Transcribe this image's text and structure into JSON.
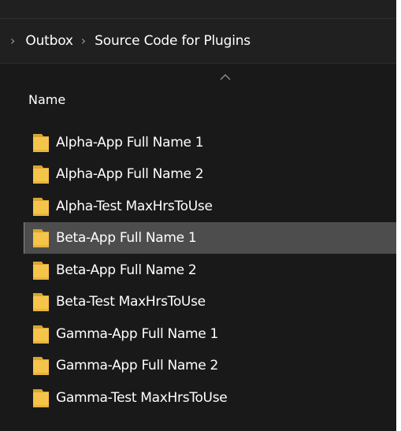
{
  "breadcrumb": {
    "items": [
      "Outbox",
      "Source Code for Plugins"
    ]
  },
  "columns": {
    "name": "Name",
    "sort_direction": "ascending"
  },
  "icons": {
    "folder": "folder-icon",
    "sort": "chevron-up-icon",
    "separator": "chevron-right-icon"
  },
  "colors": {
    "folder": "#F4C54A",
    "selection": "#4D4D4D",
    "background": "#191919"
  },
  "files": [
    {
      "name": "Alpha-App Full Name 1",
      "selected": false
    },
    {
      "name": "Alpha-App Full Name 2",
      "selected": false
    },
    {
      "name": "Alpha-Test MaxHrsToUse",
      "selected": false
    },
    {
      "name": "Beta-App Full Name 1",
      "selected": true
    },
    {
      "name": "Beta-App Full Name 2",
      "selected": false
    },
    {
      "name": "Beta-Test MaxHrsToUse",
      "selected": false
    },
    {
      "name": "Gamma-App Full Name 1",
      "selected": false
    },
    {
      "name": "Gamma-App Full Name 2",
      "selected": false
    },
    {
      "name": "Gamma-Test MaxHrsToUse",
      "selected": false
    }
  ]
}
